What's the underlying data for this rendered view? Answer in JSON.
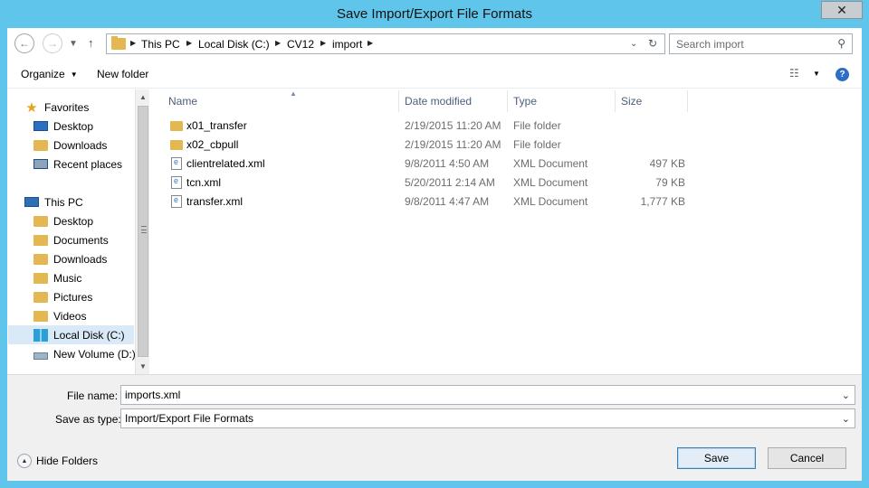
{
  "window": {
    "title": "Save Import/Export File Formats",
    "close_glyph": "✕"
  },
  "address": {
    "crumbs": [
      "This PC",
      "Local Disk (C:)",
      "CV12",
      "import"
    ],
    "search_placeholder": "Search import"
  },
  "toolbar": {
    "organize_label": "Organize",
    "new_folder_label": "New folder"
  },
  "nav": {
    "favorites": {
      "label": "Favorites",
      "items": [
        {
          "label": "Desktop",
          "icon": "desktop-icon"
        },
        {
          "label": "Downloads",
          "icon": "downloads-folder-icon"
        },
        {
          "label": "Recent places",
          "icon": "recent-places-icon"
        }
      ]
    },
    "this_pc": {
      "label": "This PC",
      "items": [
        {
          "label": "Desktop",
          "icon": "folder-icon"
        },
        {
          "label": "Documents",
          "icon": "folder-icon"
        },
        {
          "label": "Downloads",
          "icon": "folder-icon"
        },
        {
          "label": "Music",
          "icon": "folder-icon"
        },
        {
          "label": "Pictures",
          "icon": "folder-icon"
        },
        {
          "label": "Videos",
          "icon": "folder-icon"
        },
        {
          "label": "Local Disk (C:)",
          "icon": "windows-drive-icon",
          "selected": true
        },
        {
          "label": "New Volume (D:)",
          "icon": "drive-icon"
        }
      ]
    }
  },
  "columns": [
    "Name",
    "Date modified",
    "Type",
    "Size"
  ],
  "files": [
    {
      "name": "x01_transfer",
      "date": "2/19/2015 11:20 AM",
      "type": "File folder",
      "size": "",
      "kind": "folder"
    },
    {
      "name": "x02_cbpull",
      "date": "2/19/2015 11:20 AM",
      "type": "File folder",
      "size": "",
      "kind": "folder"
    },
    {
      "name": "clientrelated.xml",
      "date": "9/8/2011 4:50 AM",
      "type": "XML Document",
      "size": "497 KB",
      "kind": "xml"
    },
    {
      "name": "tcn.xml",
      "date": "5/20/2011 2:14 AM",
      "type": "XML Document",
      "size": "79 KB",
      "kind": "xml"
    },
    {
      "name": "transfer.xml",
      "date": "9/8/2011 4:47 AM",
      "type": "XML Document",
      "size": "1,777 KB",
      "kind": "xml"
    }
  ],
  "form": {
    "file_name_label": "File name:",
    "file_name_value": "imports.xml",
    "save_type_label": "Save as type:",
    "save_type_value": "Import/Export File Formats"
  },
  "footer": {
    "hide_folders_label": "Hide Folders",
    "save_label": "Save",
    "cancel_label": "Cancel"
  },
  "colors": {
    "titlebar": "#5fc5ea",
    "selection": "#d9e9f7",
    "folder": "#e3b752"
  }
}
